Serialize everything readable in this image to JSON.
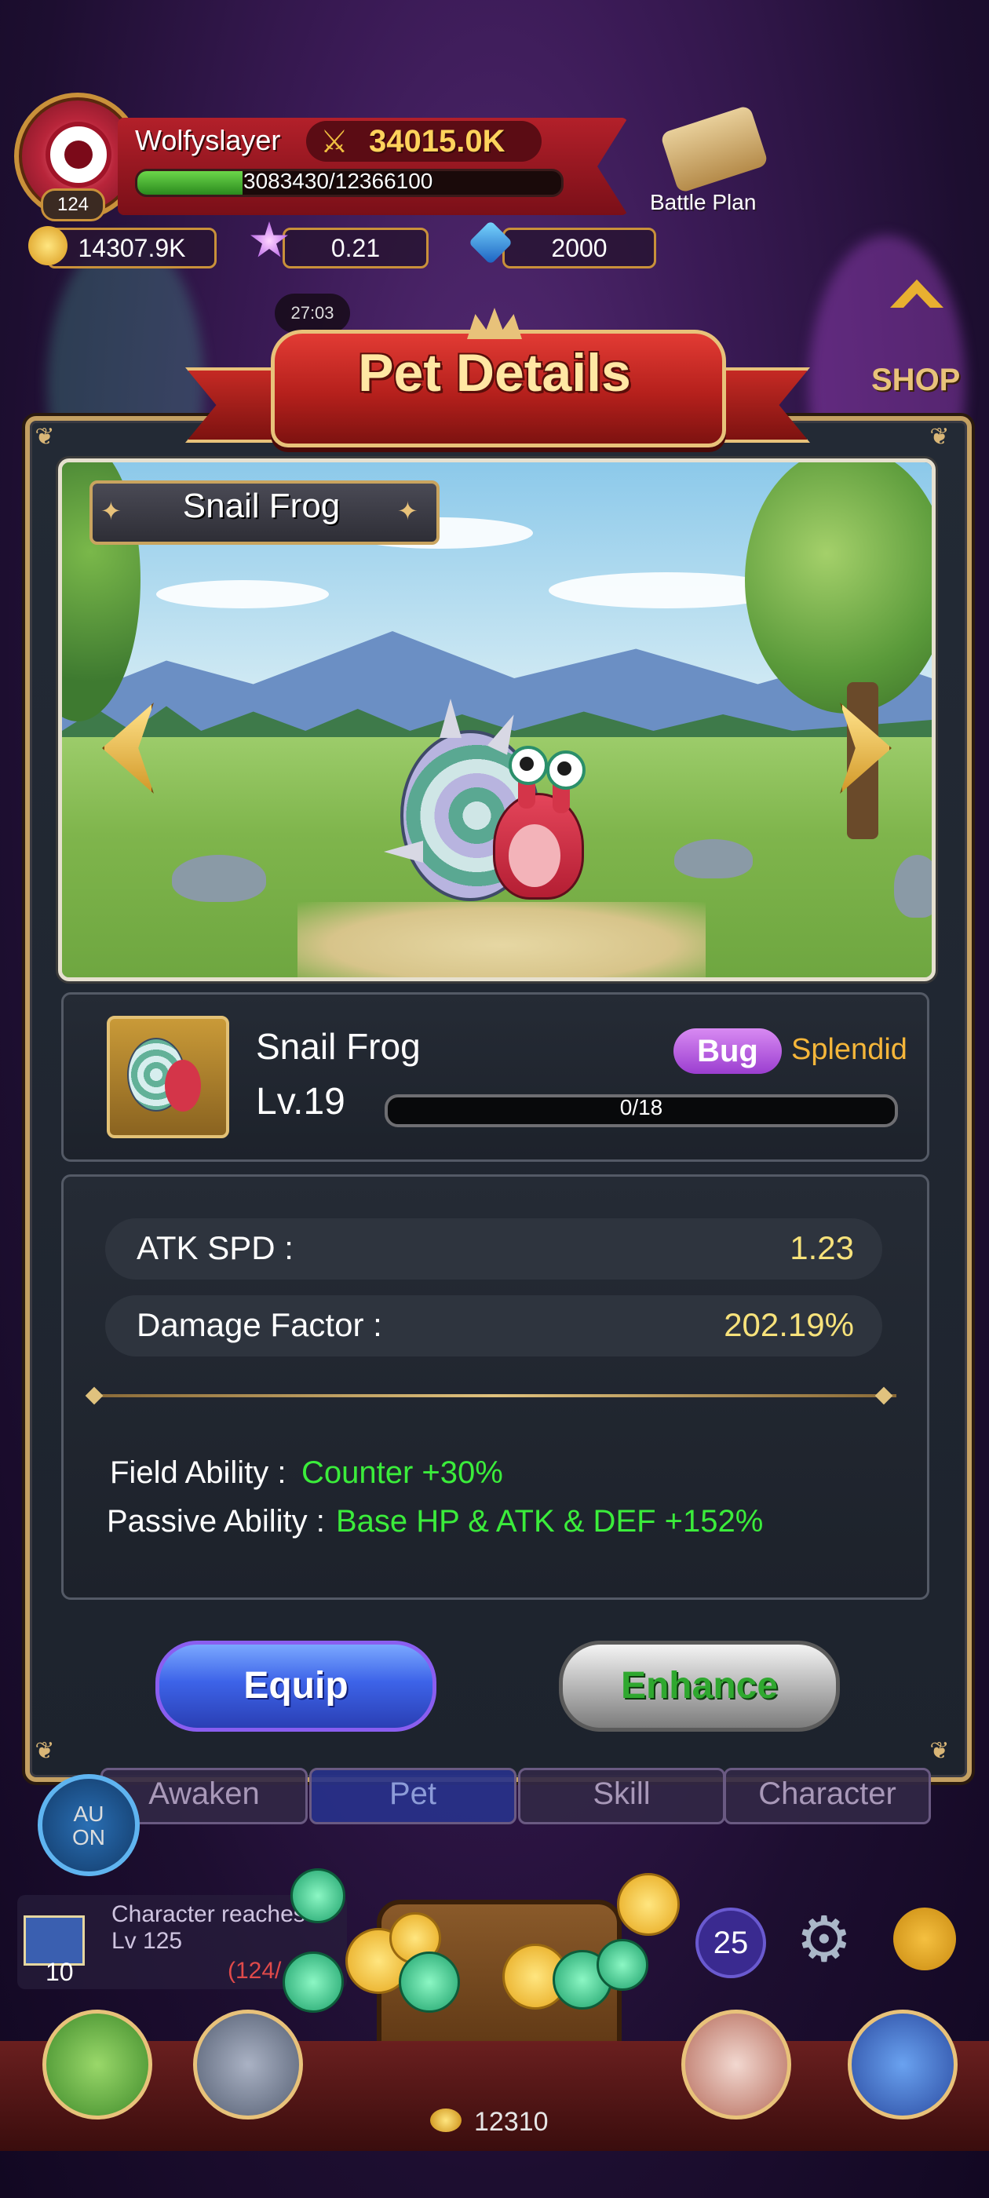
{
  "player": {
    "name": "Wolfyslayer",
    "level": "124",
    "power": "34015.0K",
    "xp_text": "3083430/12366100",
    "xp_fraction": 0.249
  },
  "resources": {
    "gold": "14307.9K",
    "stars": "0.21",
    "gems": "2000"
  },
  "hud": {
    "battle_plan": "Battle Plan",
    "timer": "27:03"
  },
  "modal": {
    "title": "Pet Details",
    "pet_name_banner": "Snail Frog"
  },
  "pet": {
    "name": "Snail Frog",
    "level": "Lv.19",
    "type": "Bug",
    "rarity": "Splendid",
    "exp_text": "0/18",
    "exp_fraction": 0
  },
  "stats": [
    {
      "label": "ATK SPD :",
      "value": "1.23"
    },
    {
      "label": "Damage Factor :",
      "value": "202.19%"
    }
  ],
  "abilities": {
    "field_label": "Field Ability :",
    "field_value": "Counter +30%",
    "passive_label": "Passive Ability :",
    "passive_value": "Base HP & ATK & DEF +152%"
  },
  "buttons": {
    "equip": "Equip",
    "enhance": "Enhance"
  },
  "bottom": {
    "tabs": [
      "Awaken",
      "Pet",
      "Skill",
      "Character"
    ],
    "auto": "AU\nON",
    "quest_text_1": "Character reaches",
    "quest_text_2": "Lv 125",
    "quest_count": "10",
    "quest_progress": "(124/",
    "badge": "25",
    "currency": "12310"
  },
  "colors": {
    "accent_gold": "#c4a062",
    "ribbon_red": "#b5201c",
    "stat_yellow": "#f7e27b",
    "ability_green": "#3bed3b",
    "bug_purple": "#b55ce0",
    "rarity_orange": "#f5b63a"
  }
}
